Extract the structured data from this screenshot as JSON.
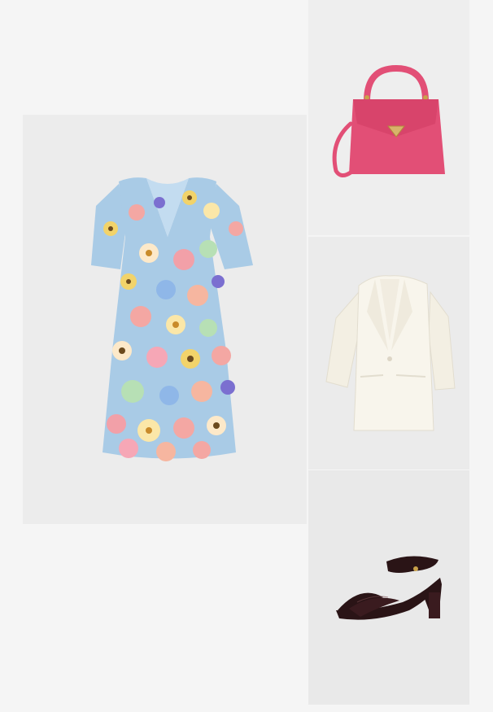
{
  "outfit": {
    "items": [
      {
        "category": "dress",
        "icon": "floral-dress-icon"
      },
      {
        "category": "handbag",
        "icon": "pink-handbag-icon"
      },
      {
        "category": "blazer",
        "icon": "white-blazer-icon"
      },
      {
        "category": "sandals",
        "icon": "black-heeled-sandal-icon"
      }
    ],
    "colors": {
      "page_background": "#f5f5f5",
      "dress_base": "#a9cbe6",
      "bag": "#e24f76",
      "blazer": "#f8f5ec",
      "sandal": "#2a1416"
    }
  }
}
